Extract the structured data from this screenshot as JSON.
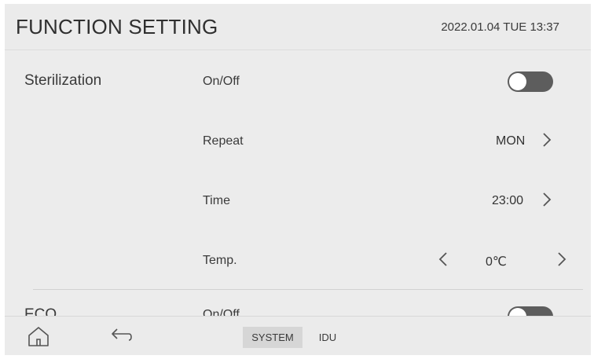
{
  "header": {
    "title": "FUNCTION SETTING",
    "datetime": "2022.01.04 TUE 13:37"
  },
  "sections": {
    "sterilization": {
      "label": "Sterilization",
      "onoff": {
        "label": "On/Off",
        "state": "off"
      },
      "repeat": {
        "label": "Repeat",
        "value": "MON"
      },
      "time": {
        "label": "Time",
        "value": "23:00"
      },
      "temp": {
        "label": "Temp.",
        "value": "0℃"
      }
    },
    "eco": {
      "label": "ECO",
      "onoff": {
        "label": "On/Off",
        "state": "off"
      }
    }
  },
  "icons": {
    "home": "home-icon",
    "back": "back-arrow-icon",
    "next": "chevron-right-icon",
    "prev": "chevron-left-icon"
  },
  "footer": {
    "tabs": [
      {
        "label": "SYSTEM",
        "active": true
      },
      {
        "label": "IDU",
        "active": false
      }
    ]
  },
  "colors": {
    "toggle_off": "#5d5d5d",
    "background": "#e8e8e8"
  }
}
